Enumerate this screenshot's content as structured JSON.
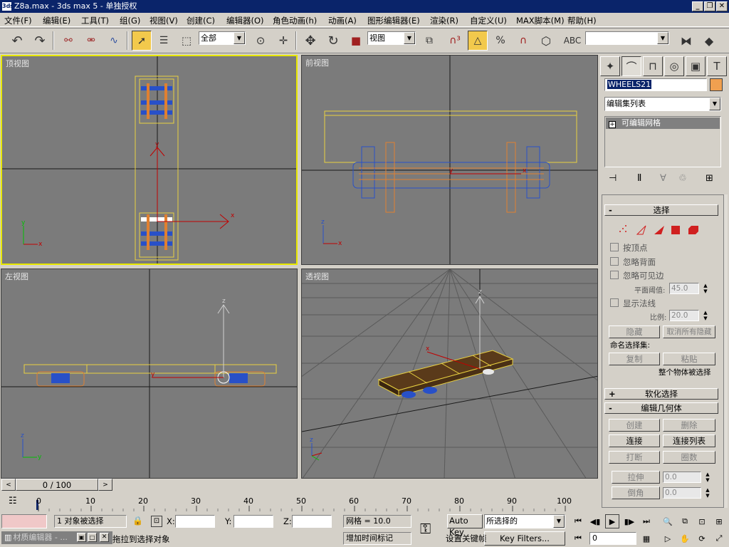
{
  "window": {
    "title": "Z8a.max - 3ds max 5 - 单独授权",
    "icon": "3ds-max-icon"
  },
  "menu": [
    "文件(F)",
    "编辑(E)",
    "工具(T)",
    "组(G)",
    "视图(V)",
    "创建(C)",
    "编辑器(O)",
    "角色动画(h)",
    "动画(A)",
    "图形编辑器(E)",
    "渲染(R)",
    "自定义(U)",
    "MAX脚本(M)",
    "帮助(H)"
  ],
  "toolbar": {
    "selection_filter": "全部",
    "ref_coord": "视图",
    "named_set": ""
  },
  "viewports": {
    "top": "顶视图",
    "front": "前视图",
    "left": "左视图",
    "persp": "透视图"
  },
  "command_panel": {
    "object_name": "WHEELS21",
    "object_color": "#f0a050",
    "modifier_list": "编辑集列表",
    "stack_item": "可编辑网格",
    "selection": {
      "title": "选择",
      "by_vertex": "按顶点",
      "ignore_backfacing": "忽略背面",
      "ignore_visible_edges": "忽略可见边",
      "planar_thresh_label": "平面阈值:",
      "planar_thresh_value": "45.0",
      "show_normals": "显示法线",
      "scale_label": "比例:",
      "scale_value": "20.0",
      "hide": "隐藏",
      "unhide_all": "取消所有隐藏",
      "named_sets": "命名选择集:",
      "copy": "复制",
      "paste": "粘贴",
      "whole_object": "整个物体被选择"
    },
    "soft_selection": "软化选择",
    "edit_geometry": {
      "title": "编辑几何体",
      "create": "创建",
      "delete": "删除",
      "attach": "连接",
      "attach_list": "连接列表",
      "break": "打断",
      "turn": "圈数",
      "extrude": "拉伸",
      "extrude_value": "0.0",
      "chamfer": "倒角",
      "chamfer_value": "0.0"
    }
  },
  "timeline": {
    "frame": "0 / 100",
    "ticks": [
      "0",
      "10",
      "20",
      "30",
      "40",
      "50",
      "60",
      "70",
      "80",
      "90",
      "100"
    ]
  },
  "status": {
    "selected": "1 对象被选择",
    "prompt": "拖拉到选择对象",
    "x_label": "X:",
    "y_label": "Y:",
    "z_label": "Z:",
    "grid": "网格 = 10.0",
    "add_time_tag": "增加时间标记",
    "auto_key": "Auto Key",
    "set_key": "设置关键帧",
    "key_mode": "所选择的",
    "key_filters": "Key Filters...",
    "current_frame": "0",
    "mini_listener": "材质编辑器 - ..."
  },
  "colors": {
    "active_viewport_border": "#e8e800",
    "viewport_bg": "#7b7b7b",
    "title_bg": "#0a246a",
    "object_yellow": "#e8d040",
    "wheel_blue": "#2850c8",
    "wheel_orange": "#e08030"
  }
}
